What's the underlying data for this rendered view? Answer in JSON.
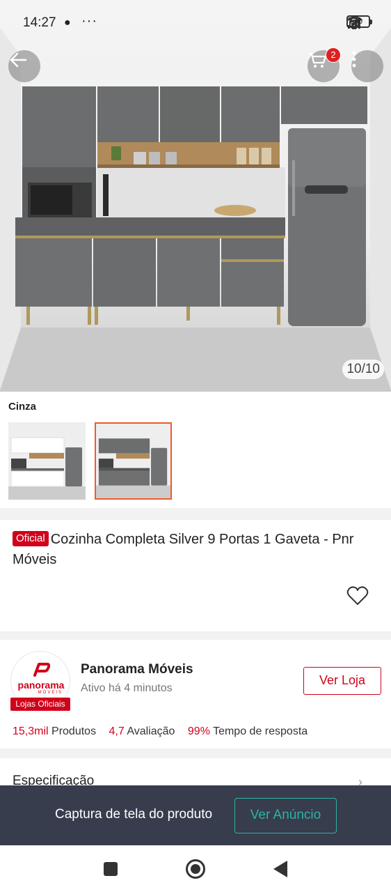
{
  "status_bar": {
    "time": "14:27",
    "chat_icon": "chat-bubble-icon",
    "more_dots": "···",
    "battery": "40"
  },
  "gallery": {
    "counter": "10/10",
    "cart_count": "2"
  },
  "variant": {
    "label": "Cinza"
  },
  "product": {
    "badge": "Oficial",
    "title": "Cozinha Completa Silver 9 Portas 1 Gaveta - Pnr Móveis"
  },
  "shop": {
    "logo_text": "panorama",
    "logo_sub": "MÓVEIS",
    "tag": "Lojas Oficiais",
    "name": "Panorama Móveis",
    "active": "Ativo há 4 minutos",
    "visit_button": "Ver Loja",
    "stats": {
      "products_value": "15,3mil",
      "products_label": "Produtos",
      "rating_value": "4,7",
      "rating_label": "Avaliação",
      "response_value": "99%",
      "response_label": "Tempo de resposta"
    }
  },
  "spec": {
    "label": "Especificação"
  },
  "capture": {
    "text": "Captura de tela do produto",
    "button": "Ver Anúncio"
  },
  "colors": {
    "brand_red": "#d0021b",
    "accent_orange": "#ee5a2a",
    "teal": "#2bb3a3",
    "capture_bar_bg": "#373d4d"
  }
}
